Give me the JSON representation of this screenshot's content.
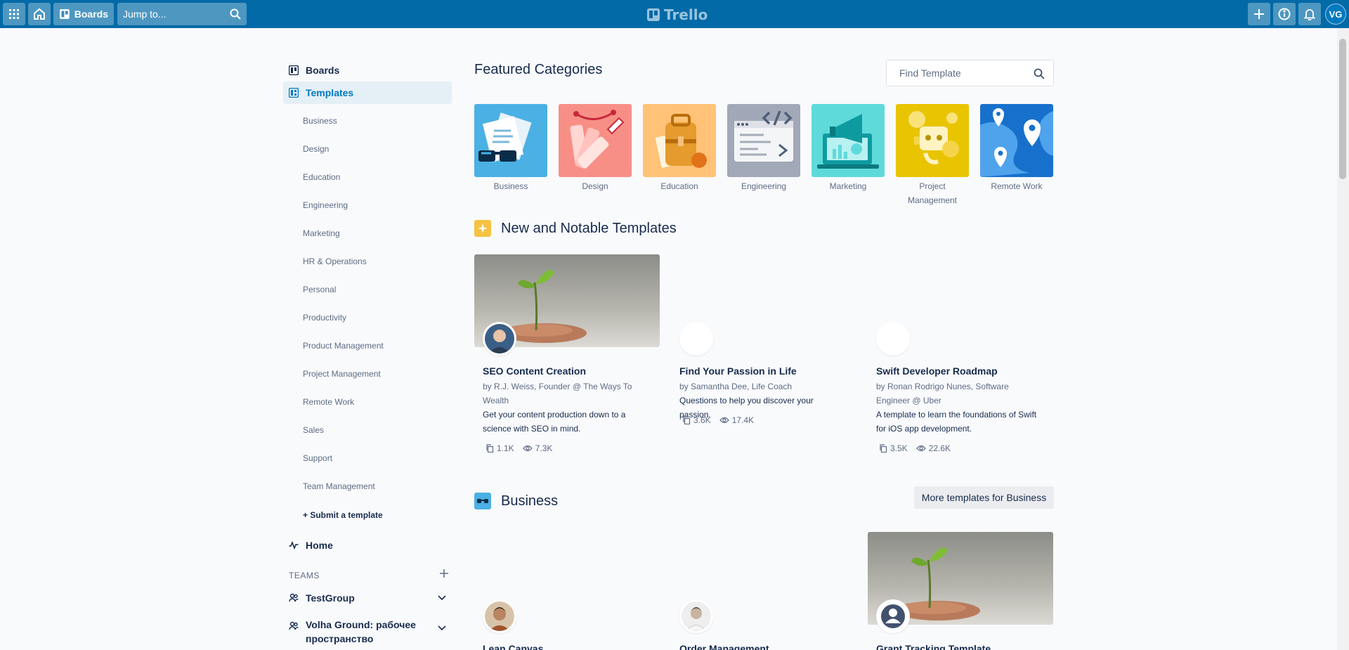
{
  "topbar": {
    "boards_label": "Boards",
    "search_placeholder": "Jump to...",
    "logo_text": "Trello",
    "avatar_initials": "VG",
    "color": "#026aa7"
  },
  "sidebar": {
    "boards": "Boards",
    "templates": "Templates",
    "categories": [
      "Business",
      "Design",
      "Education",
      "Engineering",
      "Marketing",
      "HR & Operations",
      "Personal",
      "Productivity",
      "Product Management",
      "Project Management",
      "Remote Work",
      "Sales",
      "Support",
      "Team Management"
    ],
    "submit": "+ Submit a template",
    "home": "Home",
    "teams_label": "TEAMS",
    "teams": [
      {
        "name": "TestGroup"
      },
      {
        "name": "Volha Ground: рабочее пространство"
      }
    ]
  },
  "featured": {
    "title": "Featured Categories",
    "search_placeholder": "Find Template",
    "categories": [
      {
        "label": "Business",
        "icon": "briefcase-papers-glasses-icon",
        "color": "#4bb0e4"
      },
      {
        "label": "Design",
        "icon": "color-palette-icon",
        "color": "#f88f86"
      },
      {
        "label": "Education",
        "icon": "backpack-icon",
        "color": "#ffc277"
      },
      {
        "label": "Engineering",
        "icon": "code-window-icon",
        "color": "#a1a8b7"
      },
      {
        "label": "Marketing",
        "icon": "megaphone-laptop-icon",
        "color": "#5fdadb"
      },
      {
        "label": "Project Management",
        "icon": "robot-gears-icon",
        "color": "#e9c400"
      },
      {
        "label": "Remote Work",
        "icon": "map-pins-icon",
        "color": "#1771cc"
      }
    ]
  },
  "notable": {
    "title": "New and Notable Templates",
    "cards": [
      {
        "title": "SEO Content Creation",
        "by": "by R.J. Weiss, Founder @ The Ways To Wealth",
        "desc": "Get your content production down to a science with SEO in mind.",
        "copies": "1.1K",
        "views": "7.3K"
      },
      {
        "title": "Find Your Passion in Life",
        "by": "by Samantha Dee, Life Coach",
        "desc": "Questions to help you discover your passion.",
        "copies": "3.6K",
        "views": "17.4K"
      },
      {
        "title": "Swift Developer Roadmap",
        "by": "by Ronan Rodrigo Nunes, Software Engineer @ Uber",
        "desc": "A template to learn the foundations of Swift for iOS app development.",
        "copies": "3.5K",
        "views": "22.6K"
      }
    ]
  },
  "business": {
    "title": "Business",
    "more_button": "More templates for Business",
    "cards": [
      {
        "title": "Lean Canvas"
      },
      {
        "title": "Order Management"
      },
      {
        "title": "Grant Tracking Template"
      }
    ]
  }
}
